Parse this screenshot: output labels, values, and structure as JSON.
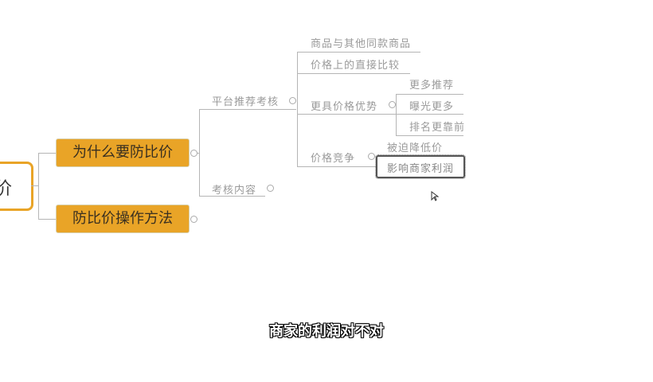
{
  "mindmap": {
    "central": "价",
    "branches": [
      {
        "label": "为什么要防比价"
      },
      {
        "label": "防比价操作方法"
      }
    ],
    "sub": {
      "platform": "平台推荐考核",
      "content": "考核内容"
    },
    "items": {
      "compare_a": "商品与其他同款商品",
      "compare_b": "价格上的直接比较",
      "advantage": "更具价格优势",
      "competition": "价格竞争",
      "more_rec": "更多推荐",
      "exposure": "曝光更多",
      "rank": "排名更靠前",
      "forced": "被迫降低价",
      "profit": "影响商家利润"
    },
    "accent": "#e9a427"
  },
  "subtitle": "商家的利润对不对"
}
